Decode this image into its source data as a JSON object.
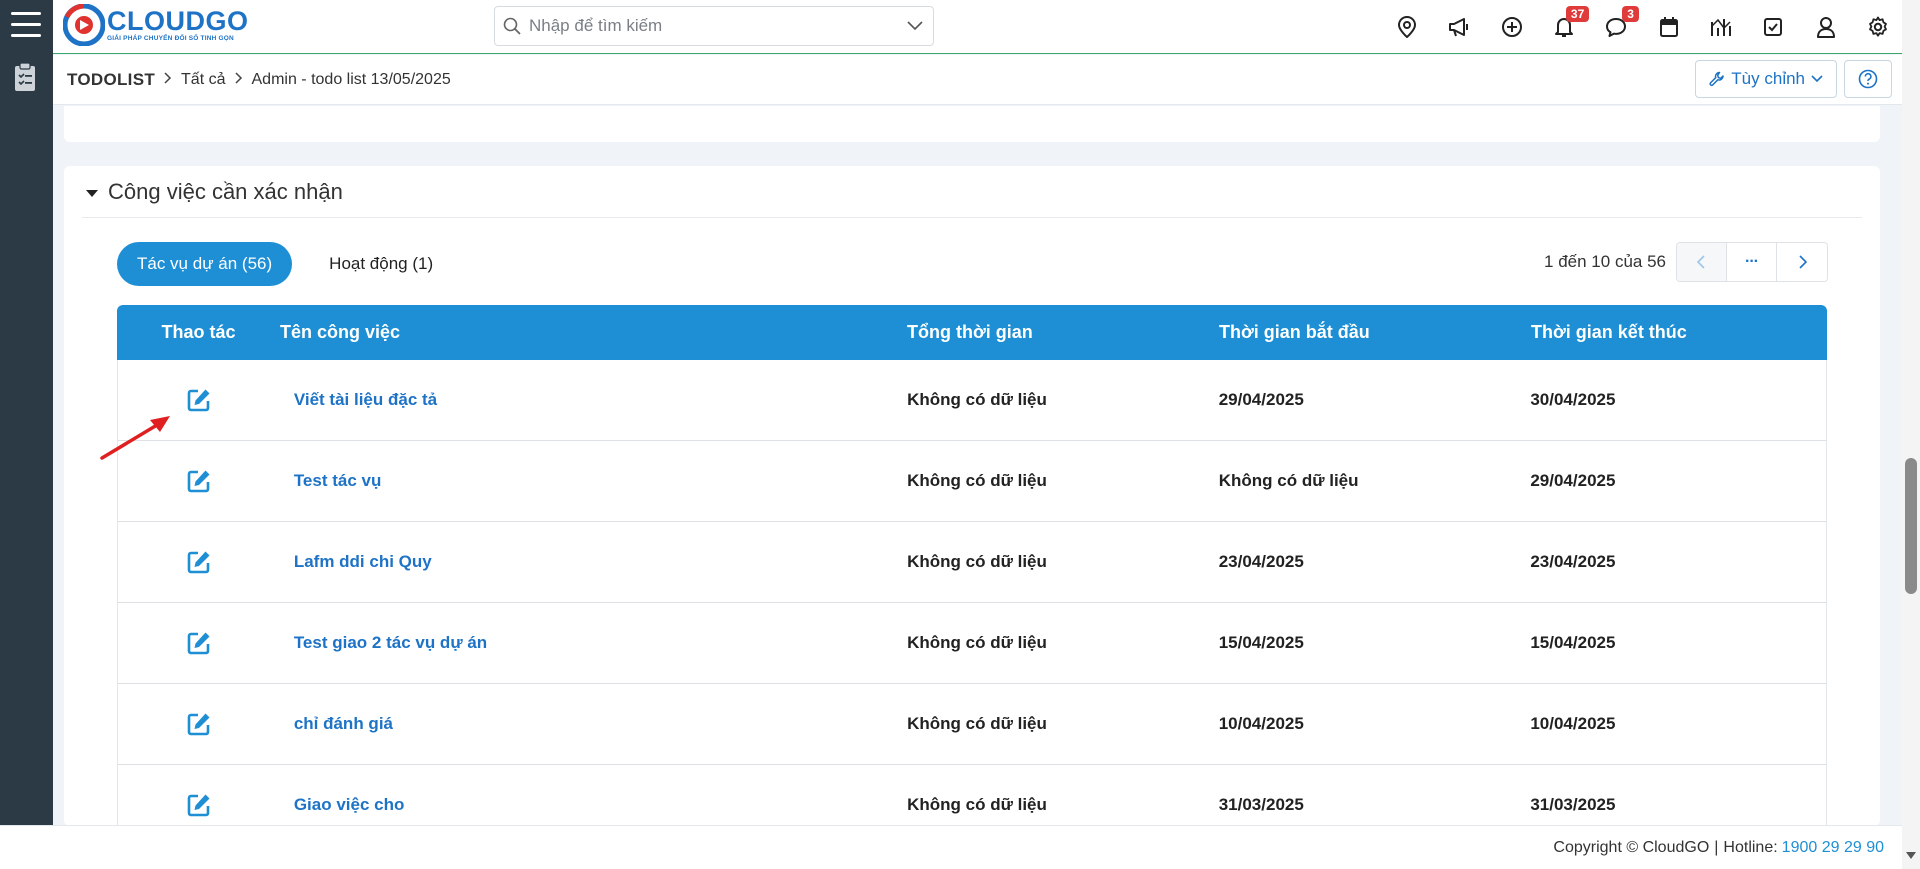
{
  "header": {
    "logo_text": "CLOUDGO",
    "logo_tagline": "GIẢI PHÁP CHUYỂN ĐỔI SỐ TINH GỌN",
    "search_placeholder": "Nhập để tìm kiếm",
    "notification_count": "37",
    "message_count": "3",
    "icons": [
      "location-icon",
      "megaphone-icon",
      "plus-circle-icon",
      "bell-icon",
      "chat-icon",
      "calendar-icon",
      "chart-icon",
      "checkbox-icon",
      "user-icon",
      "gear-icon"
    ]
  },
  "breadcrumb": {
    "root": "TODOLIST",
    "level1": "Tất cả",
    "level2": "Admin - todo list 13/05/2025"
  },
  "actions": {
    "customize_label": "Tùy chỉnh"
  },
  "section": {
    "title": "Công việc cần xác nhận",
    "tabs": [
      {
        "label": "Tác vụ dự án (56)",
        "active": true
      },
      {
        "label": "Hoạt động (1)",
        "active": false
      }
    ],
    "pagination": {
      "info": "1 đến 10 của 56",
      "more": "···"
    },
    "table": {
      "columns": [
        "Thao tác",
        "Tên công việc",
        "Tổng thời gian",
        "Thời gian bắt đầu",
        "Thời gian kết thúc"
      ],
      "rows": [
        {
          "name": "Viết tài liệu đặc tả",
          "total": "Không có dữ liệu",
          "start": "29/04/2025",
          "end": "30/04/2025"
        },
        {
          "name": "Test tác vụ",
          "total": "Không có dữ liệu",
          "start": "Không có dữ liệu",
          "end": "29/04/2025"
        },
        {
          "name": "Lafm ddi chi Quy",
          "total": "Không có dữ liệu",
          "start": "23/04/2025",
          "end": "23/04/2025"
        },
        {
          "name": "Test giao 2 tác vụ dự án",
          "total": "Không có dữ liệu",
          "start": "15/04/2025",
          "end": "15/04/2025"
        },
        {
          "name": "chỉ đánh giá",
          "total": "Không có dữ liệu",
          "start": "10/04/2025",
          "end": "10/04/2025"
        },
        {
          "name": "Giao việc cho",
          "total": "Không có dữ liệu",
          "start": "31/03/2025",
          "end": "31/03/2025"
        }
      ]
    }
  },
  "footer": {
    "copyright": "Copyright © CloudGO",
    "separator": "|",
    "hotline_label": "Hotline:",
    "hotline_number": "1900 29 29 90"
  },
  "colors": {
    "primary": "#1e8fd4",
    "brand": "#1e73c6",
    "sidebar": "#2b3a44",
    "badge": "#e03b3b",
    "annotation_arrow": "#e02020"
  }
}
